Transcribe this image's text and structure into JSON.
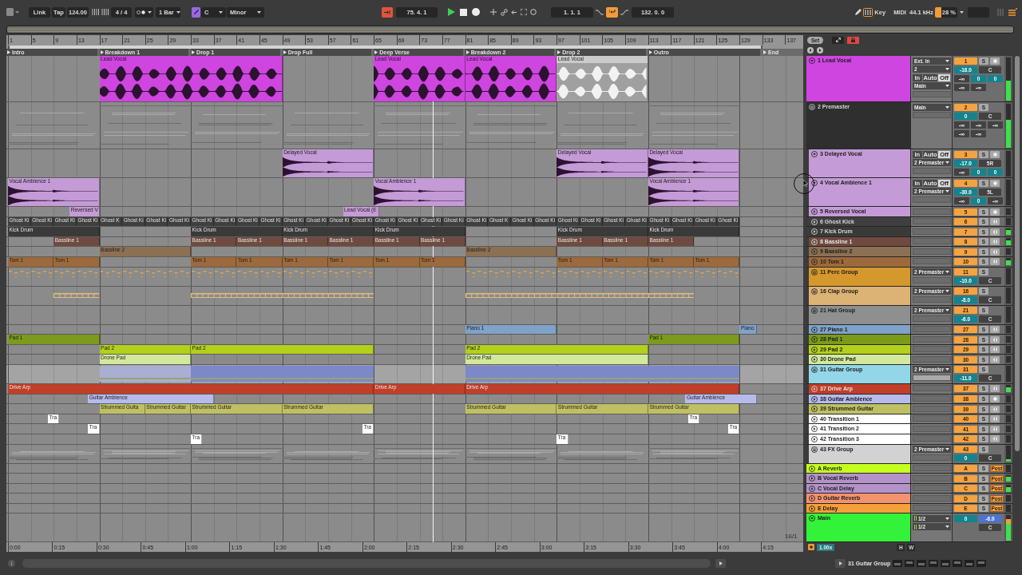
{
  "toolbar": {
    "link": "Link",
    "tap": "Tap",
    "tempo": "124.00",
    "time_signature": "4 / 4",
    "quantization": "1 Bar",
    "scale_mode_on": true,
    "key": "C",
    "scale": "Minor",
    "back_to_arrangement": true,
    "position": "75. 4. 1",
    "playing": true,
    "loop_start": "1. 1. 1",
    "loop_on": true,
    "loop_length": "132. 0. 0",
    "computer_keyboard_on": true,
    "key_map": "Key",
    "midi_map": "MIDI",
    "sample_rate": "44.1 kHz",
    "cpu": {
      "reading": "28 %",
      "level": 0.28
    }
  },
  "ruler": {
    "bars": [
      "1",
      "5",
      "9",
      "13",
      "17",
      "21",
      "25",
      "29",
      "33",
      "37",
      "41",
      "45",
      "49",
      "53",
      "57",
      "61",
      "65",
      "69",
      "73",
      "77",
      "81",
      "85",
      "89",
      "93",
      "97",
      "101",
      "105",
      "109",
      "113",
      "117",
      "121",
      "125",
      "129",
      "133",
      "137"
    ],
    "set": "Set"
  },
  "locators": [
    {
      "name": "Intro"
    },
    {
      "name": "Breakdown 1"
    },
    {
      "name": "Drop 1"
    },
    {
      "name": "Drop Full"
    },
    {
      "name": "Deep Verse"
    },
    {
      "name": "Breakdown 2"
    },
    {
      "name": "Drop 2"
    },
    {
      "name": "Outro"
    },
    {
      "name": "End"
    }
  ],
  "tracks": [
    {
      "name": "1 Lead Vocal",
      "kind": "audio",
      "color": "#cf45e0",
      "expanded": true,
      "selected": false,
      "clips": [
        {
          "name": "Lead Vocal",
          "active": true
        },
        {
          "name": "Lead Vocal",
          "active": true
        },
        {
          "name": "Lead Vocal",
          "active": true
        },
        {
          "name": "Lead Vocal",
          "active": false
        }
      ],
      "io": [
        {
          "kind": "dropdown",
          "value": "Ext. In"
        },
        {
          "kind": "dropdown",
          "value": "2"
        },
        {
          "kind": "monitor",
          "options": [
            {
              "label": "In",
              "selected": false
            },
            {
              "label": "Auto",
              "selected": false
            },
            {
              "label": "Off",
              "selected": true
            }
          ]
        },
        {
          "kind": "dropdown",
          "value": "Main"
        }
      ],
      "mixer": {
        "number": "1",
        "solo": "S",
        "volume": "-16.0",
        "pan": "C",
        "sends": [
          {
            "value": "-∞",
            "on": false
          },
          {
            "value": "0",
            "on": true
          },
          {
            "value": "0",
            "on": true
          },
          {
            "value": "-∞",
            "on": false
          },
          {
            "value": "-∞",
            "on": false
          }
        ]
      },
      "level": 0.45
    },
    {
      "name": "2 Premaster",
      "kind": "group",
      "color": "#2f2f2f",
      "selected": false,
      "io": [
        {
          "kind": "dropdown",
          "value": "Main"
        }
      ],
      "mixer": {
        "number": "2",
        "solo": "S",
        "volume": "0",
        "pan": "C",
        "sends": [
          {
            "value": "-∞",
            "on": false
          },
          {
            "value": "-∞",
            "on": false
          },
          {
            "value": "-∞",
            "on": false
          },
          {
            "value": "-∞",
            "on": false
          },
          {
            "value": "-∞",
            "on": false
          }
        ]
      },
      "level": 0.62,
      "children": [
        {
          "name": "3 Delayed Vocal",
          "kind": "audio",
          "color": "#c49bd6",
          "expanded": true,
          "selected": false,
          "clips": [
            {
              "name": "Delayed Vocal"
            },
            {
              "name": "Delayed Vocal"
            },
            {
              "name": "Delayed Vocal"
            }
          ],
          "io": [
            {
              "kind": "monitor",
              "options": [
                {
                  "label": "In",
                  "selected": false
                },
                {
                  "label": "Auto",
                  "selected": false
                },
                {
                  "label": "Off",
                  "selected": true
                }
              ]
            },
            {
              "kind": "dropdown",
              "value": "2 Premaster"
            }
          ],
          "mixer": {
            "number": "3",
            "solo": "S",
            "volume": "-17.0",
            "pan": "5R",
            "sends": [
              {
                "value": "-∞",
                "on": false
              },
              {
                "value": "0",
                "on": true
              },
              {
                "value": "0",
                "on": true
              }
            ]
          }
        },
        {
          "name": "4 Vocal Ambience 1",
          "kind": "audio",
          "color": "#c49bd6",
          "expanded": true,
          "selected": false,
          "clips": [
            {
              "name": "Vocal Ambience 1"
            },
            {
              "name": "Vocal Ambience 1"
            },
            {
              "name": "Vocal Ambience 1"
            }
          ],
          "io": [
            {
              "kind": "monitor",
              "options": [
                {
                  "label": "In",
                  "selected": false
                },
                {
                  "label": "Auto",
                  "selected": false
                },
                {
                  "label": "Off",
                  "selected": true
                }
              ]
            },
            {
              "kind": "dropdown",
              "value": "2 Premaster"
            }
          ],
          "mixer": {
            "number": "4",
            "solo": "S",
            "volume": "-30.0",
            "pan": "5L",
            "sends": [
              {
                "value": "-∞",
                "on": false
              },
              {
                "value": "0",
                "on": true
              },
              {
                "value": "-∞",
                "on": false
              }
            ]
          }
        },
        {
          "name": "5 Reversed Vocal",
          "kind": "audio",
          "color": "#c49bd6",
          "expanded": false,
          "selected": false,
          "clips": [
            {
              "name": "Reversed V"
            },
            {
              "name": "Lead Vocal (E"
            }
          ],
          "mixer": {
            "number": "5",
            "solo": "S"
          }
        },
        {
          "name": "6 Ghost Kick",
          "kind": "midi",
          "color": "#3f3f3f",
          "expanded": false,
          "selected": false,
          "clips": [
            {
              "name": "Ghost Ki"
            },
            {
              "name": "Ghost Ki"
            },
            {
              "name": "Ghost Ki"
            },
            {
              "name": "Ghost Ki"
            },
            {
              "name": "Ghost K"
            },
            {
              "name": "Ghost Ki"
            },
            {
              "name": "Ghost Ki"
            },
            {
              "name": "Ghost Ki"
            },
            {
              "name": "Ghost Ki"
            },
            {
              "name": "Ghost Ki"
            },
            {
              "name": "Ghost Ki"
            },
            {
              "name": "Ghost Ki"
            },
            {
              "name": "Ghost Ki"
            },
            {
              "name": "Ghost Ki"
            },
            {
              "name": "Ghost Ki"
            },
            {
              "name": "Ghost Ki"
            },
            {
              "name": "Ghost Ki"
            },
            {
              "name": "Ghost Ki"
            },
            {
              "name": "Ghost Ki"
            },
            {
              "name": "Ghost Ki"
            },
            {
              "name": "Ghost Ki"
            },
            {
              "name": "Ghost K"
            },
            {
              "name": "Ghost Ki"
            },
            {
              "name": "Ghost Ki"
            },
            {
              "name": "Ghost Ki"
            },
            {
              "name": "Ghost Ki"
            },
            {
              "name": "Ghost Ki"
            },
            {
              "name": "Ghost Ki"
            },
            {
              "name": "Ghost Ki"
            },
            {
              "name": "Ghost Ki"
            },
            {
              "name": "Ghost Ki"
            },
            {
              "name": "Ghost Ki"
            }
          ],
          "mixer": {
            "number": "6",
            "solo": "S"
          }
        },
        {
          "name": "7 Kick Drum",
          "kind": "midi",
          "color": "#3a3a3a",
          "expanded": false,
          "selected": false,
          "clips": [
            {
              "name": "Kick Drum"
            },
            {
              "name": "Kick Drum"
            },
            {
              "name": "Kick Drum"
            },
            {
              "name": "Kick Drum"
            },
            {
              "name": "Kick Drum"
            },
            {
              "name": "Kick Drum"
            }
          ],
          "mixer": {
            "number": "7",
            "solo": "S"
          },
          "signal": true
        },
        {
          "name": "8 Bassline 1",
          "kind": "midi",
          "color": "#6f4a3f",
          "expanded": false,
          "selected": false,
          "clips": [
            {
              "name": "Bassline 1"
            },
            {
              "name": "Bassline 1"
            },
            {
              "name": "Bassline 1"
            },
            {
              "name": "Bassline 1"
            },
            {
              "name": "Bassline 1"
            },
            {
              "name": "Bassline 1"
            },
            {
              "name": "Bassline 1"
            },
            {
              "name": "Bassline 1"
            },
            {
              "name": "Bassline 1"
            },
            {
              "name": "Bassline 1"
            }
          ],
          "mixer": {
            "number": "8",
            "solo": "S"
          },
          "signal": true
        },
        {
          "name": "9 Bassline 2",
          "kind": "midi",
          "color": "#8c7054",
          "expanded": false,
          "selected": false,
          "clips": [
            {
              "name": "Bassline 2"
            },
            {
              "name": "Bassline 2"
            }
          ],
          "mixer": {
            "number": "9",
            "solo": "S"
          }
        },
        {
          "name": "10 Tom 1",
          "kind": "midi",
          "color": "#9c6a3c",
          "expanded": false,
          "selected": false,
          "clips": [
            {
              "name": "Tom 1"
            },
            {
              "name": "Tom 1"
            },
            {
              "name": "Tom 1"
            },
            {
              "name": "Tom 1"
            },
            {
              "name": "Tom 1"
            },
            {
              "name": "Tom 1"
            },
            {
              "name": "Tom 1"
            },
            {
              "name": "Tom 1"
            },
            {
              "name": "Tom 1"
            },
            {
              "name": "Tom 1"
            },
            {
              "name": "Tom 1"
            },
            {
              "name": "Tom 1"
            }
          ],
          "mixer": {
            "number": "10",
            "solo": "S"
          },
          "signal": true
        },
        {
          "name": "11 Perc Group",
          "kind": "group",
          "color": "#d4982c",
          "selected": false,
          "io": [
            {
              "kind": "dropdown",
              "value": "2 Premaster"
            }
          ],
          "mixer": {
            "number": "11",
            "solo": "S",
            "volume": "-10.0",
            "pan": "C"
          }
        },
        {
          "name": "16 Clap Group",
          "kind": "group",
          "color": "#dcb275",
          "selected": false,
          "io": [
            {
              "kind": "dropdown",
              "value": "2 Premaster"
            }
          ],
          "mixer": {
            "number": "16",
            "solo": "S",
            "volume": "-8.0",
            "pan": "C"
          }
        },
        {
          "name": "21 Hat Group",
          "kind": "group",
          "color": "#8f8f8f",
          "selected": false,
          "io": [
            {
              "kind": "dropdown",
              "value": "2 Premaster"
            }
          ],
          "mixer": {
            "number": "21",
            "solo": "S",
            "volume": "-6.0",
            "pan": "C"
          }
        },
        {
          "name": "27 Piano 1",
          "kind": "midi",
          "color": "#7fa2c9",
          "expanded": false,
          "selected": false,
          "clips": [
            {
              "name": "Piano 1"
            },
            {
              "name": "Piano"
            }
          ],
          "mixer": {
            "number": "27",
            "solo": "S"
          }
        },
        {
          "name": "28 Pad 1",
          "kind": "midi",
          "color": "#7c9a1c",
          "expanded": false,
          "selected": false,
          "clips": [
            {
              "name": "Pad 1"
            },
            {
              "name": "Pad 1"
            }
          ],
          "mixer": {
            "number": "28",
            "solo": "S"
          }
        },
        {
          "name": "29 Pad 2",
          "kind": "midi",
          "color": "#b2d01c",
          "expanded": false,
          "selected": false,
          "clips": [
            {
              "name": "Pad 2"
            },
            {
              "name": "Pad 2"
            },
            {
              "name": "Pad 2"
            }
          ],
          "mixer": {
            "number": "29",
            "solo": "S"
          }
        },
        {
          "name": "30 Drone Pad",
          "kind": "midi",
          "color": "#d2e99c",
          "expanded": false,
          "selected": false,
          "clips": [
            {
              "name": "Drone Pad"
            },
            {
              "name": "Drone Pad"
            }
          ],
          "mixer": {
            "number": "30",
            "solo": "S"
          }
        },
        {
          "name": "31 Guitar Group",
          "kind": "group",
          "color": "#93d6e8",
          "selected": true,
          "io": [
            {
              "kind": "dropdown",
              "value": "2 Premaster"
            }
          ],
          "mixer": {
            "number": "31",
            "solo": "S",
            "volume": "-11.0",
            "pan": "C"
          }
        },
        {
          "name": "37 Drive Arp",
          "kind": "midi",
          "color": "#c13e29",
          "expanded": false,
          "selected": false,
          "clips": [
            {
              "name": "Drive Arp"
            },
            {
              "name": "Drive Arp"
            },
            {
              "name": "Drive Arp"
            }
          ],
          "mixer": {
            "number": "37",
            "solo": "S"
          },
          "signal": true
        },
        {
          "name": "38 Guitar Ambience",
          "kind": "audio",
          "color": "#b6bbec",
          "expanded": false,
          "selected": false,
          "clips": [
            {
              "name": "Guitar Ambience"
            },
            {
              "name": "Guitar Ambience"
            }
          ],
          "mixer": {
            "number": "38",
            "solo": "S"
          }
        },
        {
          "name": "39 Strummed Guitar",
          "kind": "midi",
          "color": "#bfc063",
          "expanded": false,
          "selected": false,
          "clips": [
            {
              "name": "Strummed Guita"
            },
            {
              "name": "Strummed Guitar"
            },
            {
              "name": "Strummed Guitar"
            },
            {
              "name": "Strummed Guitar"
            },
            {
              "name": "Strummed Guitar"
            },
            {
              "name": "Strummed Guitar"
            },
            {
              "name": "Strummed Guitar"
            }
          ],
          "mixer": {
            "number": "39",
            "solo": "S"
          }
        },
        {
          "name": "40 Transition 1",
          "kind": "midi",
          "color": "#ffffff",
          "expanded": false,
          "selected": false,
          "clips": [
            {
              "name": "Tra"
            },
            {
              "name": "Tra"
            }
          ],
          "mixer": {
            "number": "40",
            "solo": "S"
          }
        },
        {
          "name": "41 Transition 2",
          "kind": "midi",
          "color": "#ffffff",
          "expanded": false,
          "selected": false,
          "clips": [
            {
              "name": "Tra"
            },
            {
              "name": "Tra"
            },
            {
              "name": "Tra"
            }
          ],
          "mixer": {
            "number": "41",
            "solo": "S"
          }
        },
        {
          "name": "42 Transition 3",
          "kind": "midi",
          "color": "#ffffff",
          "expanded": false,
          "selected": false,
          "clips": [
            {
              "name": "Tra"
            },
            {
              "name": "Tra"
            }
          ],
          "mixer": {
            "number": "42",
            "solo": "S"
          }
        },
        {
          "name": "43 FX Group",
          "kind": "group",
          "color": "#d2d2d2",
          "selected": false,
          "io": [
            {
              "kind": "dropdown",
              "value": "2 Premaster"
            }
          ],
          "mixer": {
            "number": "43",
            "solo": "S",
            "volume": "0",
            "pan": "C"
          },
          "level": 0.15
        }
      ]
    },
    {
      "name": "A Reverb",
      "kind": "return",
      "color": "#c6ff1e",
      "expanded": false,
      "selected": false,
      "mixer": {
        "number": "A",
        "solo": "S",
        "post": "Post"
      }
    },
    {
      "name": "B Vocal Reverb",
      "kind": "return",
      "color": "#b392c9",
      "expanded": false,
      "selected": false,
      "mixer": {
        "number": "B",
        "solo": "S",
        "post": "Post"
      },
      "signal": true
    },
    {
      "name": "C Vocal Delay",
      "kind": "return",
      "color": "#b392c9",
      "expanded": false,
      "selected": false,
      "mixer": {
        "number": "C",
        "solo": "S",
        "post": "Post"
      },
      "signal": true
    },
    {
      "name": "D Guitar Reverb",
      "kind": "return",
      "color": "#f2926f",
      "expanded": false,
      "selected": false,
      "mixer": {
        "number": "D",
        "solo": "S",
        "post": "Post"
      }
    },
    {
      "name": "E Delay",
      "kind": "return",
      "color": "#f5a03a",
      "expanded": false,
      "selected": false,
      "mixer": {
        "number": "E",
        "solo": "S",
        "post": "Post"
      }
    },
    {
      "name": "Main",
      "kind": "main",
      "color": "#33f23a",
      "expanded": true,
      "selected": false,
      "io": [
        {
          "kind": "dropdown",
          "value": "1/2"
        },
        {
          "kind": "dropdown",
          "value": "1/2"
        }
      ],
      "mixer": {
        "cue": "0",
        "volume": "-6.0",
        "pan": "C"
      },
      "level": 0.85
    }
  ],
  "time_ruler": [
    "0:00",
    "0:15",
    "0:30",
    "0:45",
    "1:00",
    "1:15",
    "1:30",
    "1:45",
    "2:00",
    "2:15",
    "2:30",
    "2:45",
    "3:00",
    "3:15",
    "3:30",
    "3:45",
    "4:00",
    "4:15"
  ],
  "grid": "16/1",
  "zoom": "1.00x",
  "height_buttons": [
    "H",
    "W"
  ],
  "status": {
    "selected_track": "31 Guitar Group"
  }
}
